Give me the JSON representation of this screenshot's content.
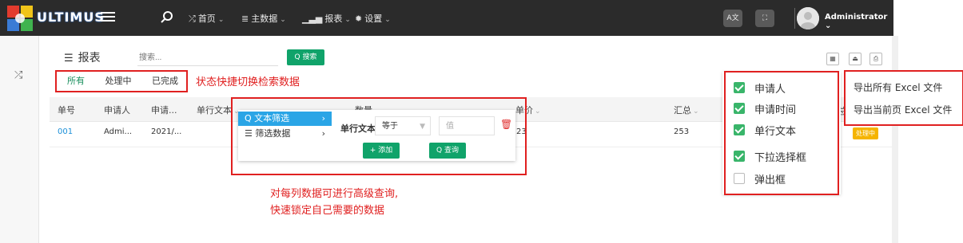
{
  "topbar": {
    "brand": "ULTIMUS",
    "nav": [
      {
        "icon": "shuffle-icon",
        "label": "首页"
      },
      {
        "icon": "database-icon",
        "label": "主数据"
      },
      {
        "icon": "bar-chart-icon",
        "label": "报表"
      },
      {
        "icon": "gear-icon",
        "label": "设置"
      }
    ],
    "translate_icon_text": "A文",
    "user_name": "Administrator"
  },
  "page": {
    "title": "报表",
    "search_placeholder": "搜索...",
    "search_button": "搜索",
    "tabs": [
      "所有",
      "处理中",
      "已完成"
    ]
  },
  "annotations": {
    "status_tip": "状态快捷切换检索数据",
    "query_tip_line1": "对每列数据可进行高级查询,",
    "query_tip_line2": "快速锁定自己需要的数据"
  },
  "table": {
    "headers": [
      "单号",
      "申请人",
      "申请...",
      "单行文本",
      "数量",
      "单价",
      "汇总",
      "总"
    ],
    "row": {
      "id": "001",
      "applicant": "Admi...",
      "date": "2021/...",
      "price": "23",
      "total": "253",
      "status": "处理中"
    }
  },
  "filter_popup": {
    "menu": [
      "文本筛选",
      "筛选数据"
    ],
    "field_label": "单行文本",
    "operator": "等于",
    "value_placeholder": "值",
    "add_button": "添加",
    "query_button": "查询"
  },
  "column_chooser": [
    {
      "label": "申请人",
      "checked": true
    },
    {
      "label": "申请时间",
      "checked": true
    },
    {
      "label": "单行文本",
      "checked": true
    },
    {
      "label": "下拉选择框",
      "checked": true
    },
    {
      "label": "弹出框",
      "checked": false
    }
  ],
  "export_menu": [
    "导出所有 Excel 文件",
    "导出当前页 Excel 文件"
  ]
}
